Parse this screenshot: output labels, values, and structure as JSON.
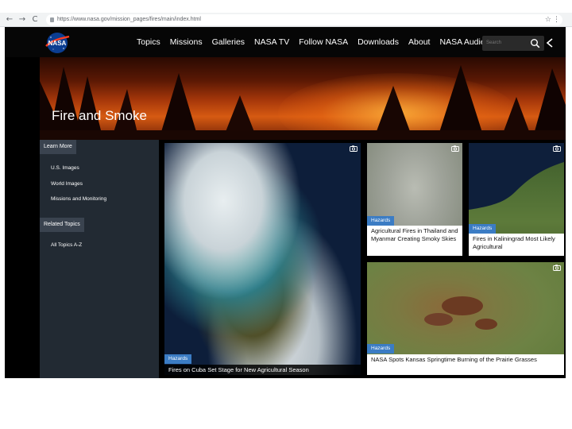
{
  "browser": {
    "url": "https://www.nasa.gov/mission_pages/fires/main/index.html",
    "back": "←",
    "forward": "→",
    "reload": "C",
    "star": "☆",
    "menu": "⋮"
  },
  "header": {
    "logo_text": "NASA",
    "nav": [
      "Topics",
      "Missions",
      "Galleries",
      "NASA TV",
      "Follow NASA",
      "Downloads",
      "About",
      "NASA Audiences"
    ],
    "search_placeholder": "Search"
  },
  "hero": {
    "title": "Fire and Smoke"
  },
  "sidebar": {
    "learn_more": "Learn More",
    "links": [
      "U.S. Images",
      "World Images",
      "Missions and Monitoring"
    ],
    "related_topics": "Related Topics",
    "related_links": [
      "All Topics A-Z"
    ]
  },
  "cards": [
    {
      "tag": "Hazards",
      "title": "Fires on Cuba Set Stage for New Agricultural Season"
    },
    {
      "tag": "Hazards",
      "title": "Agricultural Fires in Thailand and Myanmar Creating Smoky Skies"
    },
    {
      "tag": "Hazards",
      "title": "Fires in Kaliningrad Most Likely Agricultural"
    },
    {
      "tag": "Hazards",
      "title": "NASA Spots Kansas Springtime Burning of the Prairie Grasses"
    }
  ],
  "colors": {
    "tag_blue": "#3b7cc4",
    "sidebar_bg": "#222a33",
    "header_bg": "#060606"
  }
}
